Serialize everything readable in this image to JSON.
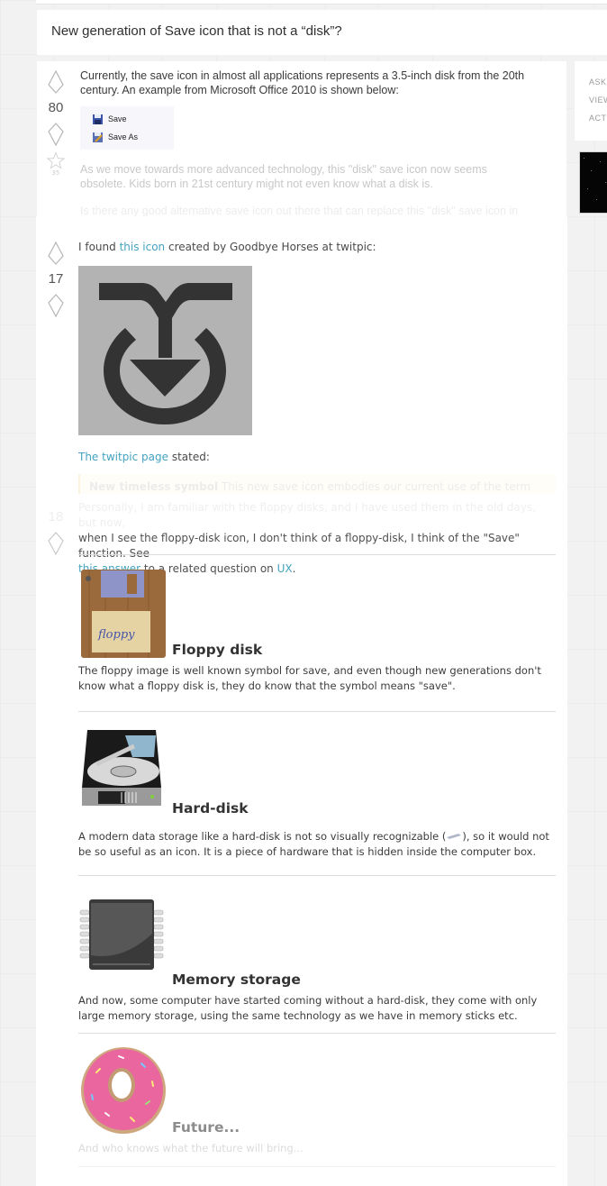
{
  "question": {
    "title": "New generation of Save icon that is not a “disk”?",
    "votes": "80",
    "favorites": "35",
    "paragraph_1": "Currently, the save icon in almost all applications represents a 3.5-inch disk from the 20th century. An example from Microsoft Office 2010 is shown below:",
    "menu_sample": [
      {
        "icon": "floppy-disk-icon",
        "label": "Save"
      },
      {
        "icon": "save-as-icon",
        "label": "Save As"
      }
    ],
    "paragraph_2": "As we move towards more advanced technology, this \"disk\" save icon now seems obsolete. Kids born in 21st century might not even know what a disk is.",
    "paragraph_3": "Is there any good alternative save icon out there that can replace this \"disk\" save icon in"
  },
  "sidebar": {
    "meta": [
      "ASKED",
      "VIEWED",
      "ACTIVE"
    ]
  },
  "answer_1": {
    "votes": "17",
    "intro_pre": "I found ",
    "intro_link": "this icon",
    "intro_post": " created by Goodbye Horses at twitpic:",
    "image_desc": "timeless-save-symbol-icon",
    "page_link": "The twitpic page",
    "page_post": " stated:",
    "quote_bold": "New timeless symbol",
    "quote_text": " This new save icon embodies our current use of the term \"save\". No"
  },
  "answer_2": {
    "votes": "18",
    "line_1": "Personally, I am familiar with the floppy disks, and I have used them in the old days, but now,",
    "line_2": "when I see the floppy-disk icon, I don't think of a floppy-disk, I think of the \"Save\" function. See",
    "link_1": "this answer",
    "mid": " to a related question on ",
    "link_2": "UX",
    "end": ".",
    "sections": [
      {
        "icon": "floppy-disk-image",
        "heading": "Floppy disk",
        "text": "The floppy image is well known symbol for save, and even though new generations don't know what a floppy disk is, they do know that the symbol means \"save\"."
      },
      {
        "icon": "hard-disk-image",
        "heading": "Hard-disk",
        "text_pre": "A modern data storage like a hard-disk is not so visually recognizable (",
        "text_post": "), so it would not be so useful as an icon. It is a piece of hardware that is hidden inside the computer box."
      },
      {
        "icon": "memory-chip-image",
        "heading": "Memory storage",
        "text": "And now, some computer have started coming without a hard-disk, they come with only large memory storage, using the same technology as we have in memory sticks etc."
      },
      {
        "icon": "donut-image",
        "heading": "Future...",
        "text": "And who knows what the future will bring..."
      }
    ]
  },
  "colors": {
    "link": "#45a3bf",
    "page_bg": "#f2f2f2",
    "card_bg": "#ffffff"
  }
}
